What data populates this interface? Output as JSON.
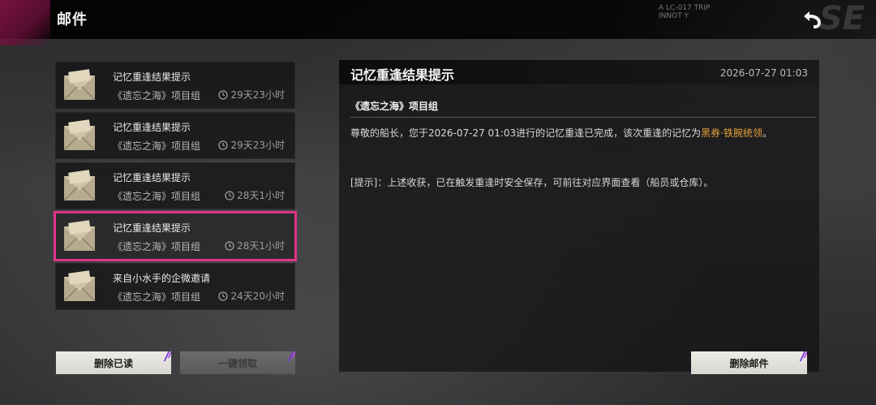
{
  "header": {
    "title": "邮件",
    "deco_text_line1": "A LC-017 TRIP",
    "deco_text_line2": "INNOT Y",
    "deco_big": "SE"
  },
  "mails": [
    {
      "title": "记忆重逢结果提示",
      "sender": "《遗忘之海》项目组",
      "time": "29天23小时",
      "selected": false
    },
    {
      "title": "记忆重逢结果提示",
      "sender": "《遗忘之海》项目组",
      "time": "29天23小时",
      "selected": false
    },
    {
      "title": "记忆重逢结果提示",
      "sender": "《遗忘之海》项目组",
      "time": "28天1小时",
      "selected": false
    },
    {
      "title": "记忆重逢结果提示",
      "sender": "《遗忘之海》项目组",
      "time": "28天1小时",
      "selected": true
    },
    {
      "title": "来自小水手的企微邀请",
      "sender": "《遗忘之海》项目组",
      "time": "24天20小时",
      "selected": false
    }
  ],
  "detail": {
    "title": "记忆重逢结果提示",
    "date": "2026-07-27 01:03",
    "sender": "《遗忘之海》项目组",
    "body_prefix": "尊敬的船长，您于2026-07-27 01:03进行的记忆重逢已完成，该次重逢的记忆为",
    "body_highlight": "黑券·铁腕统领",
    "body_suffix": "。",
    "tip": "[提示]：上述收获，已在触发重逢时安全保存，可前往对应界面查看（船员或仓库）。"
  },
  "buttons": {
    "delete_read": "删除已读",
    "claim_all": "一键领取",
    "delete_mail": "删除邮件"
  },
  "colors": {
    "accent": "#e2328a",
    "highlight": "#e3a03a"
  }
}
